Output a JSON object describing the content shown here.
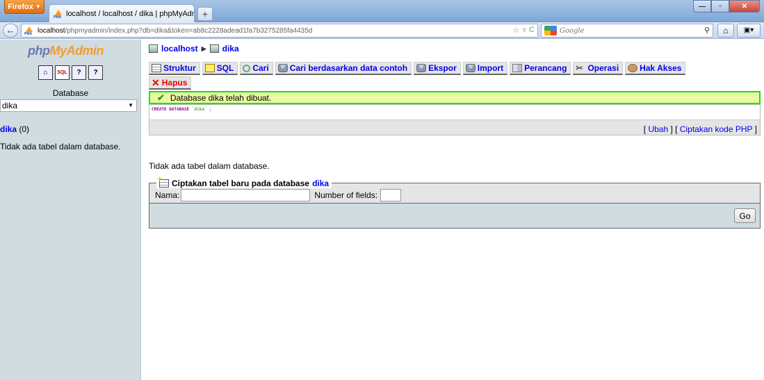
{
  "browser": {
    "menu_button": "Firefox",
    "tab_title": "localhost / localhost / dika | phpMyAdm...",
    "new_tab": "+",
    "url_host": "localhost",
    "url_rest": "/phpmyadmin/index.php?db=dika&token=ab8c2228adead1fa7b3275285fa4435d",
    "search_placeholder": "Google"
  },
  "sidebar": {
    "logo_php": "php",
    "logo_my": "My",
    "logo_admin": "Admin",
    "database_label": "Database",
    "selected_db": "dika",
    "db_link": "dika",
    "db_count": " (0)",
    "no_tables": "Tidak ada tabel dalam database."
  },
  "breadcrumb": {
    "server": "localhost",
    "database": "dika"
  },
  "tabs": [
    {
      "label": "Struktur",
      "icon": "table-icon"
    },
    {
      "label": "SQL",
      "icon": "sql-icon"
    },
    {
      "label": "Cari",
      "icon": "search-icon"
    },
    {
      "label": "Cari berdasarkan data contoh",
      "icon": "query-icon"
    },
    {
      "label": "Ekspor",
      "icon": "export-icon"
    },
    {
      "label": "Import",
      "icon": "import-icon"
    },
    {
      "label": "Perancang",
      "icon": "designer-icon"
    },
    {
      "label": "Operasi",
      "icon": "operations-icon"
    },
    {
      "label": "Hak Akses",
      "icon": "privileges-icon"
    }
  ],
  "drop_tab": "Hapus",
  "message": {
    "success_text": "Database dika telah dibuat.",
    "sql_keyword": "CREATE DATABASE",
    "sql_name": "`dika`",
    "sql_end": " ;",
    "edit_link": "Ubah",
    "php_link": "Ciptakan kode PHP"
  },
  "main": {
    "no_tables": "Tidak ada tabel dalam database."
  },
  "create_table": {
    "legend_prefix": "Ciptakan tabel baru pada database",
    "legend_db": "dika",
    "name_label": "Nama:",
    "name_value": "",
    "fields_label": "Number of fields:",
    "fields_value": "",
    "go_label": "Go"
  },
  "colors": {
    "link": "#0000ee",
    "success_border": "#00ee00",
    "success_bg": "#ebf8a4",
    "sidebar_bg": "#d0dce0"
  }
}
